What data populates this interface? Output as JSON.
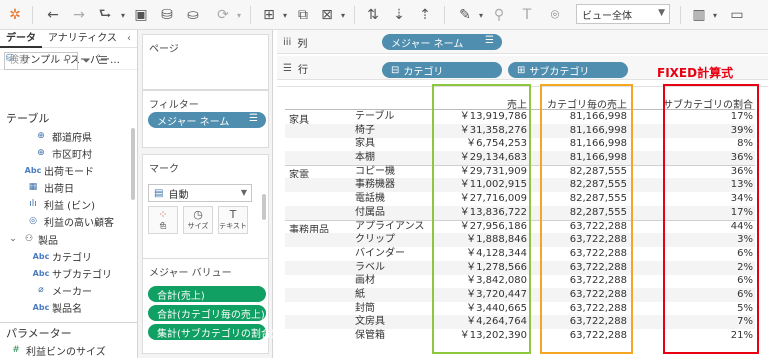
{
  "toolbar": {
    "view_size": "ビュー全体"
  },
  "data_pane": {
    "tab_data": "データ",
    "tab_analytics": "アナリティクス",
    "datasource": "サンプル - スーパー…",
    "search_placeholder": "検索",
    "tables_header": "テーブル",
    "fields": [
      {
        "icon": "globe-icon",
        "name": "都道府県"
      },
      {
        "icon": "globe-icon",
        "name": "市区町村"
      },
      {
        "icon": "abc-icon",
        "name": "出荷モード"
      },
      {
        "icon": "calendar-icon",
        "name": "出荷日"
      },
      {
        "icon": "bin-icon",
        "name": "利益 (ビン)"
      },
      {
        "icon": "set-icon",
        "name": "利益の高い顧客"
      },
      {
        "icon": "hierarchy-icon",
        "name": "製品"
      },
      {
        "icon": "abc-icon",
        "name": "カテゴリ"
      },
      {
        "icon": "abc-icon",
        "name": "サブカテゴリ"
      },
      {
        "icon": "link-icon",
        "name": "メーカー"
      },
      {
        "icon": "abc-icon",
        "name": "製品名"
      }
    ],
    "parameters_header": "パラメーター",
    "parameter": "利益ビンのサイズ"
  },
  "cards": {
    "pages": "ページ",
    "filters_title": "フィルター",
    "filter_pill": "メジャー ネーム",
    "marks_title": "マーク",
    "marks_type": "自動",
    "mark_color": "色",
    "mark_size": "サイズ",
    "mark_text": "テキスト",
    "measure_values_title": "メジャー バリュー",
    "measure_pills": [
      "合計(売上)",
      "合計(カテゴリ毎の売上)",
      "集計(サブカテゴリの割合)"
    ]
  },
  "shelves": {
    "columns_label": "列",
    "columns_pill": "メジャー ネーム",
    "rows_label": "行",
    "rows_pills": [
      "カテゴリ",
      "サブカテゴリ"
    ]
  },
  "annotation": "FIXED計算式",
  "table": {
    "headers": [
      "売上",
      "カテゴリ毎の売上",
      "サブカテゴリの割合"
    ],
    "groups": [
      {
        "category": "家具",
        "rows": [
          {
            "sub": "テーブル",
            "sales": "￥13,919,786",
            "cat_sales": "81,166,998",
            "ratio": "17%"
          },
          {
            "sub": "椅子",
            "sales": "￥31,358,276",
            "cat_sales": "81,166,998",
            "ratio": "39%"
          },
          {
            "sub": "家具",
            "sales": "￥6,754,253",
            "cat_sales": "81,166,998",
            "ratio": "8%"
          },
          {
            "sub": "本棚",
            "sales": "￥29,134,683",
            "cat_sales": "81,166,998",
            "ratio": "36%"
          }
        ]
      },
      {
        "category": "家電",
        "rows": [
          {
            "sub": "コピー機",
            "sales": "￥29,731,909",
            "cat_sales": "82,287,555",
            "ratio": "36%"
          },
          {
            "sub": "事務機器",
            "sales": "￥11,002,915",
            "cat_sales": "82,287,555",
            "ratio": "13%"
          },
          {
            "sub": "電話機",
            "sales": "￥27,716,009",
            "cat_sales": "82,287,555",
            "ratio": "34%"
          },
          {
            "sub": "付属品",
            "sales": "￥13,836,722",
            "cat_sales": "82,287,555",
            "ratio": "17%"
          }
        ]
      },
      {
        "category": "事務用品",
        "rows": [
          {
            "sub": "アプライアンス",
            "sales": "￥27,956,186",
            "cat_sales": "63,722,288",
            "ratio": "44%"
          },
          {
            "sub": "クリップ",
            "sales": "￥1,888,846",
            "cat_sales": "63,722,288",
            "ratio": "3%"
          },
          {
            "sub": "バインダー",
            "sales": "￥4,128,344",
            "cat_sales": "63,722,288",
            "ratio": "6%"
          },
          {
            "sub": "ラベル",
            "sales": "￥1,278,566",
            "cat_sales": "63,722,288",
            "ratio": "2%"
          },
          {
            "sub": "画材",
            "sales": "￥3,842,080",
            "cat_sales": "63,722,288",
            "ratio": "6%"
          },
          {
            "sub": "紙",
            "sales": "￥3,720,447",
            "cat_sales": "63,722,288",
            "ratio": "6%"
          },
          {
            "sub": "封筒",
            "sales": "￥3,440,665",
            "cat_sales": "63,722,288",
            "ratio": "5%"
          },
          {
            "sub": "文房具",
            "sales": "￥4,264,764",
            "cat_sales": "63,722,288",
            "ratio": "7%"
          },
          {
            "sub": "保管箱",
            "sales": "￥13,202,390",
            "cat_sales": "63,722,288",
            "ratio": "21%"
          }
        ]
      }
    ]
  },
  "colors": {
    "highlight_sales": "#8dc63f",
    "highlight_cat_sales": "#f5a623",
    "highlight_ratio": "#e60012",
    "annotation": "#e60012",
    "pill_blue": "#4f8eae",
    "pill_green": "#11a063"
  }
}
